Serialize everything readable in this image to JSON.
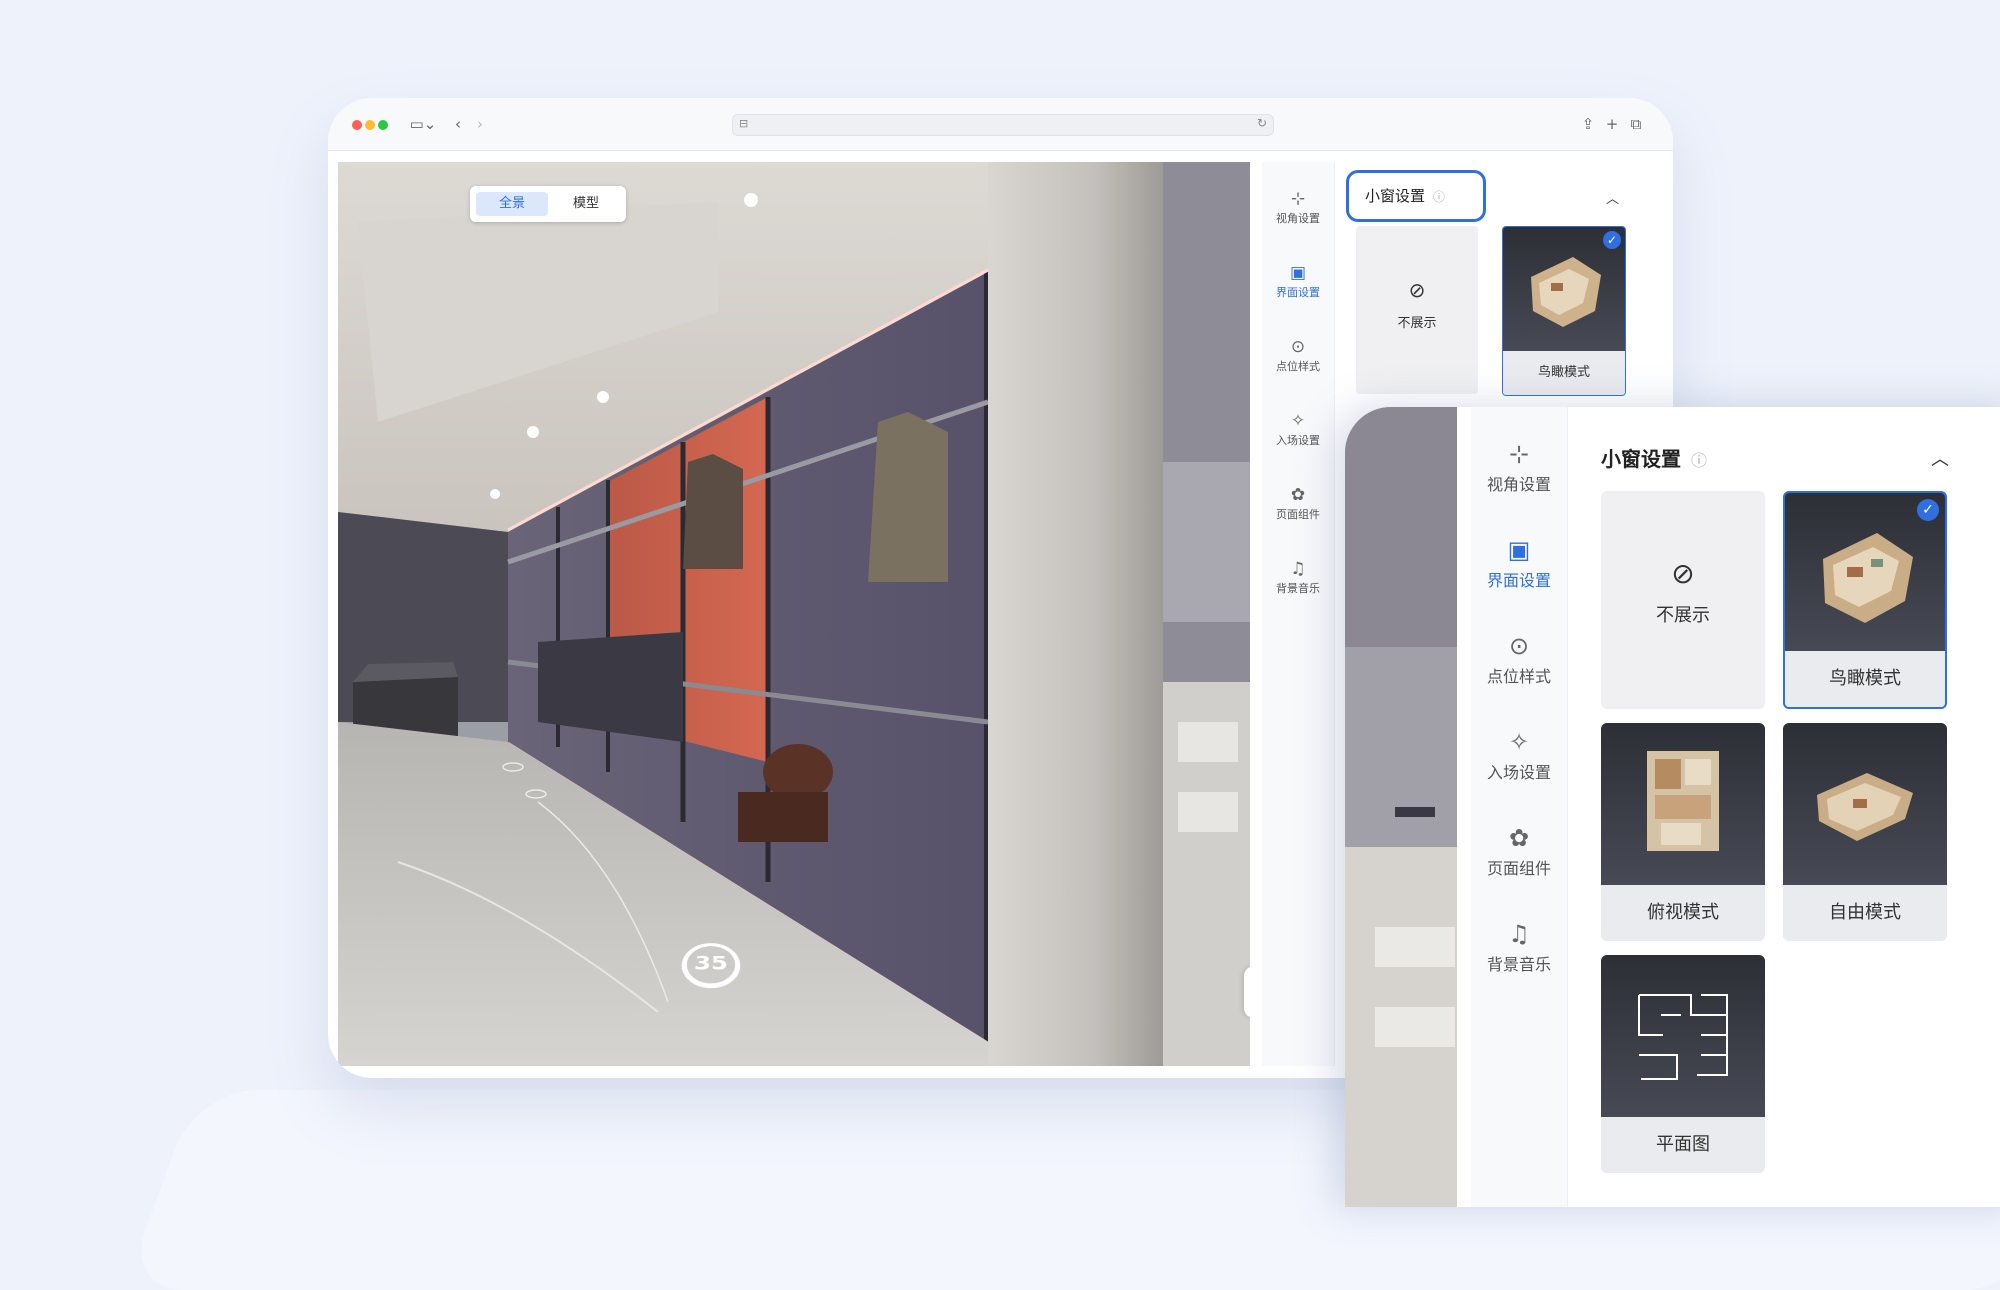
{
  "viewer": {
    "mode_tabs": [
      {
        "label": "全景",
        "active": true
      },
      {
        "label": "模型",
        "active": false
      }
    ],
    "step_number": "35"
  },
  "nav": {
    "items": [
      {
        "label": "视角设置",
        "icon": "viewpoint-icon",
        "active": false
      },
      {
        "label": "界面设置",
        "icon": "interface-icon",
        "active": true
      },
      {
        "label": "点位样式",
        "icon": "location-pin-icon",
        "active": false
      },
      {
        "label": "入场设置",
        "icon": "sparkle-icon",
        "active": false
      },
      {
        "label": "页面组件",
        "icon": "puzzle-icon",
        "active": false
      },
      {
        "label": "背景音乐",
        "icon": "music-note-icon",
        "active": false
      }
    ]
  },
  "section": {
    "title": "小窗设置",
    "options": [
      {
        "label": "不展示",
        "selected": false
      },
      {
        "label": "鸟瞰模式",
        "selected": true
      },
      {
        "label": "俯视模式",
        "selected": false
      },
      {
        "label": "自由模式",
        "selected": false
      },
      {
        "label": "平面图",
        "selected": false
      }
    ]
  },
  "colors": {
    "accent": "#2f6fe0",
    "background": "#eef2fb",
    "card": "#f0f0f2"
  }
}
